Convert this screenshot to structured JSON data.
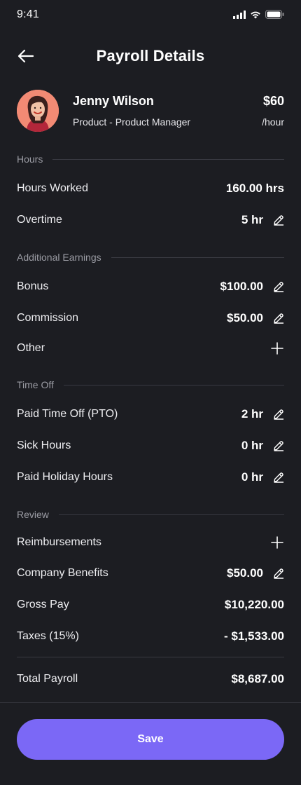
{
  "status_bar": {
    "time": "9:41"
  },
  "header": {
    "title": "Payroll Details"
  },
  "employee": {
    "name": "Jenny Wilson",
    "role": "Product - Product Manager",
    "rate": "$60",
    "rate_unit": "/hour"
  },
  "sections": {
    "hours": "Hours",
    "additional_earnings": "Additional Earnings",
    "time_off": "Time Off",
    "review": "Review"
  },
  "hours": {
    "worked_label": "Hours Worked",
    "worked_value": "160.00 hrs",
    "overtime_label": "Overtime",
    "overtime_value": "5 hr"
  },
  "earnings": {
    "bonus_label": "Bonus",
    "bonus_value": "$100.00",
    "commission_label": "Commission",
    "commission_value": "$50.00",
    "other_label": "Other"
  },
  "time_off": {
    "pto_label": "Paid Time Off (PTO)",
    "pto_value": "2 hr",
    "sick_label": "Sick Hours",
    "sick_value": "0 hr",
    "holiday_label": "Paid Holiday Hours",
    "holiday_value": "0 hr"
  },
  "review": {
    "reimbursements_label": "Reimbursements",
    "benefits_label": "Company Benefits",
    "benefits_value": "$50.00",
    "gross_label": "Gross Pay",
    "gross_value": "$10,220.00",
    "taxes_label": "Taxes (15%)",
    "taxes_value": "- $1,533.00",
    "total_label": "Total Payroll",
    "total_value": "$8,687.00"
  },
  "actions": {
    "save_label": "Save"
  },
  "colors": {
    "background": "#1c1d22",
    "accent": "#7b68f6",
    "avatar_bg": "#f28a74",
    "muted": "#9a9ba3"
  }
}
